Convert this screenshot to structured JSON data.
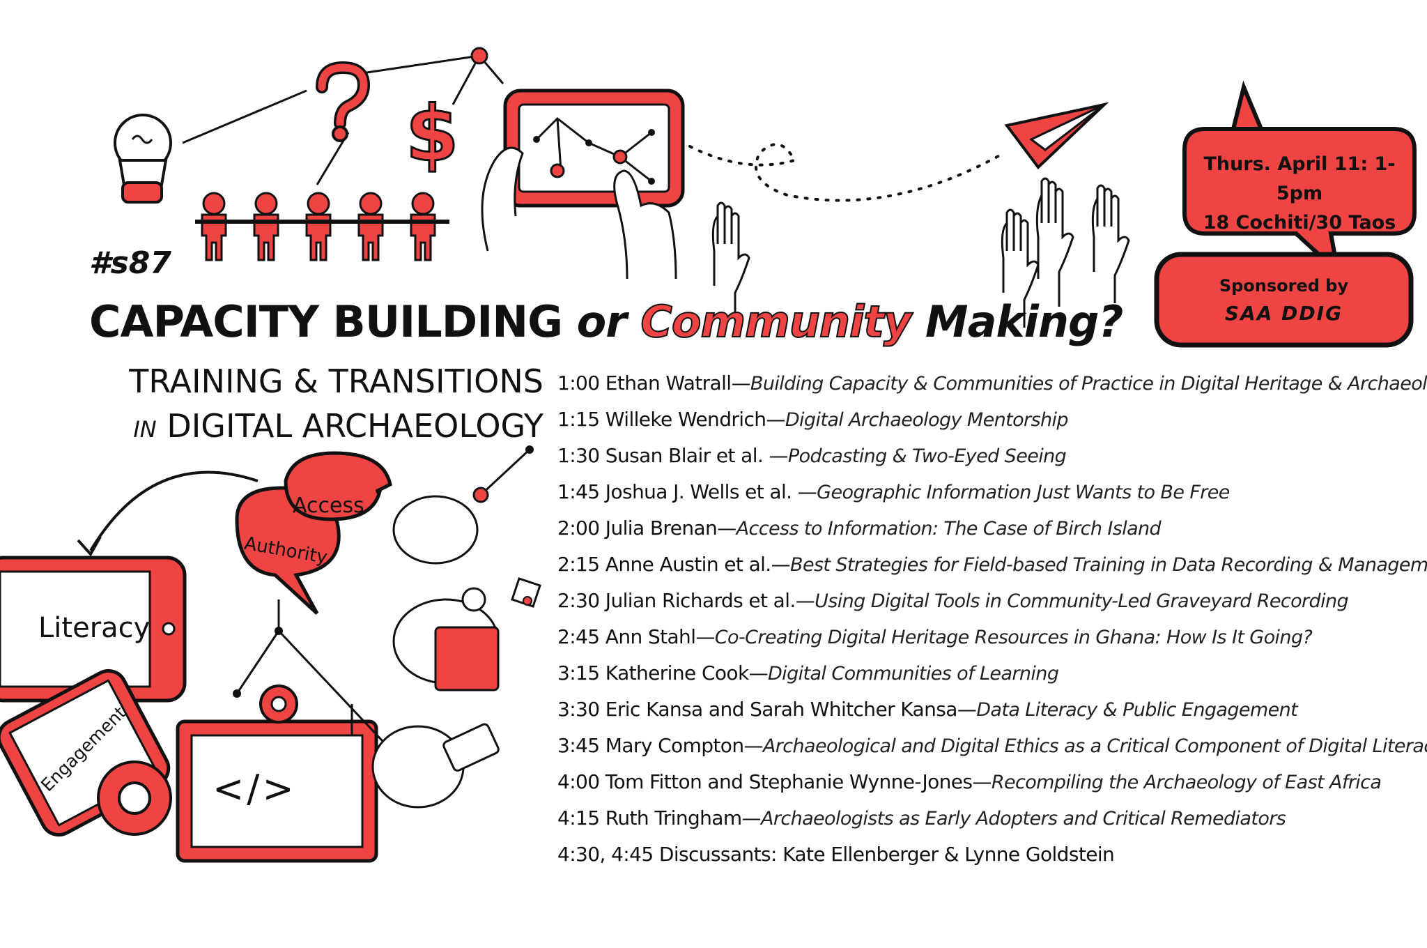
{
  "hashtag": "#s87",
  "title": {
    "part1": "CAPACITY BUILDING",
    "part2": "or",
    "part3": "Community",
    "part4": "Making?"
  },
  "subtitle": {
    "line1": "TRAINING & TRANSITIONS",
    "line2_prefix": "IN",
    "line2": "DIGITAL ARCHAEOLOGY"
  },
  "event": {
    "when": "Thurs. April 11: 1-5pm",
    "where": "18 Cochiti/30 Taos"
  },
  "sponsor": {
    "line1": "Sponsored by",
    "line2": "SAA DDIG"
  },
  "labels": {
    "access": "Access",
    "authority": "Authority",
    "literacy": "Literacy",
    "engagement": "Engagement",
    "code": "</>"
  },
  "colors": {
    "accent": "#ee4444",
    "ink": "#111111",
    "background": "#ffffff"
  },
  "schedule": [
    {
      "time": "1:00",
      "speaker": "Ethan Watrall",
      "talk": "Building Capacity & Communities of Practice in Digital Heritage & Archaeology"
    },
    {
      "time": "1:15",
      "speaker": "Willeke Wendrich",
      "talk": "Digital Archaeology Mentorship"
    },
    {
      "time": "1:30",
      "speaker": "Susan Blair et al. ",
      "talk": "Podcasting & Two-Eyed Seeing"
    },
    {
      "time": "1:45",
      "speaker": "Joshua J. Wells et al. ",
      "talk": "Geographic Information Just Wants to Be Free"
    },
    {
      "time": "2:00",
      "speaker": "Julia Brenan",
      "talk": "Access to Information: The Case of Birch Island"
    },
    {
      "time": "2:15",
      "speaker": "Anne Austin et al.",
      "talk": "Best Strategies for Field-based Training in Data Recording & Management"
    },
    {
      "time": "2:30",
      "speaker": "Julian Richards et al.",
      "talk": "Using Digital Tools in Community-Led Graveyard Recording"
    },
    {
      "time": "2:45",
      "speaker": "Ann Stahl",
      "talk": "Co-Creating Digital Heritage Resources in Ghana: How Is It Going?"
    },
    {
      "time": "3:15",
      "speaker": "Katherine Cook",
      "talk": "Digital Communities of Learning"
    },
    {
      "time": "3:30",
      "speaker": "Eric Kansa and Sarah Whitcher Kansa",
      "talk": "Data Literacy & Public Engagement"
    },
    {
      "time": "3:45",
      "speaker": "Mary Compton",
      "talk": "Archaeological and Digital Ethics as a Critical Component of Digital Literacy"
    },
    {
      "time": "4:00",
      "speaker": "Tom Fitton and Stephanie Wynne-Jones",
      "talk": "Recompiling the Archaeology of East Africa"
    },
    {
      "time": "4:15",
      "speaker": "Ruth Tringham",
      "talk": "Archaeologists as Early Adopters and Critical Remediators"
    },
    {
      "time": "4:30, 4:45",
      "speaker": "Discussants: Kate Ellenberger & Lynne Goldstein",
      "talk": ""
    }
  ]
}
